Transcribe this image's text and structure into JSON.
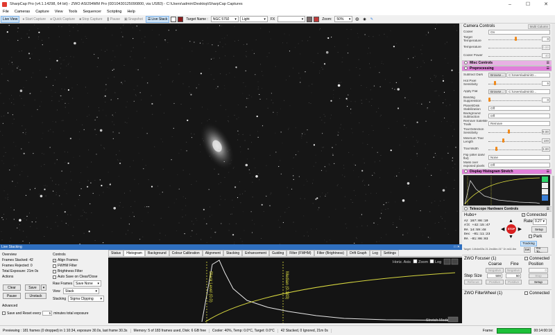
{
  "window": {
    "title": "SharpCap Pro (v4.1.14298, 64 bit) - ZWO ASI294MM Pro (0D10430125090800, via USB3) - C:\\Users\\admin\\Desktop\\SharpCap Captures"
  },
  "menu": [
    "File",
    "Cameras",
    "Capture",
    "View",
    "Tools",
    "Sequencer",
    "Scripting",
    "Help"
  ],
  "toolbar": {
    "live_view": "Live View",
    "start_capture": "Start Capture",
    "quick_capture": "Quick Capture",
    "stop_capture": "Stop Capture",
    "pause": "Pause",
    "snapshot": "Snapshot",
    "live_stack": "Live Stack",
    "target_label": "Target Name :",
    "target_value": "NGC 5792",
    "frame_type": "Light",
    "fx_label": "FX",
    "zoom_label": "Zoom:",
    "zoom_value": "50%"
  },
  "camera_controls": {
    "title": "Camera Controls",
    "multi_column": "Multi Column",
    "cooler_label": "Cooler",
    "cooler_value": "On",
    "target_temp_label": "Target Temperature",
    "target_temp_value": "0",
    "temperature_label": "Temperature",
    "temperature_value": "0.00",
    "cooler_power_label": "Cooler Power",
    "cooler_power_value": "40"
  },
  "misc_controls": {
    "title": "Misc Controls"
  },
  "preprocessing": {
    "title": "Preprocessing",
    "subtract_dark_label": "Subtract Dark",
    "browse": "Browse...",
    "subtract_dark_path": "C:\\Users\\admin\\D...",
    "hot_pixel_label": "Hot Pixel Sensitivity",
    "hot_pixel_value": "5",
    "apply_flat_label": "Apply Flat",
    "apply_flat_path": "C:\\Users\\admin\\D...",
    "banding_label": "Banding Suppression",
    "banding_value": "0",
    "planet_label": "Planet/Disk Stabilization",
    "planet_value": "Off",
    "background_label": "Background Subtraction",
    "background_value": "Off",
    "remove_trails_label": "Remove Satellite Trails",
    "remove_trails_value": "Remove",
    "trail_sens_label": "Trail Detection Sensitivity",
    "trail_sens_value": "9.00",
    "min_trail_label": "Minimum Trail Length",
    "min_trail_value": "100",
    "trail_width_label": "Trail Width",
    "trail_width_value": "3.00",
    "flip_label": "Flip (after dark/ flat)",
    "flip_value": "None",
    "mask_label": "Mask over exposed pixels",
    "mask_value": "Off"
  },
  "display_histogram": {
    "title": "Display Histogram Stretch"
  },
  "telescope": {
    "title": "Telescope Hardware Controls",
    "hubo": "Hubo+",
    "connected": "Connected",
    "az_label": "Az",
    "az_value": "167:06:10",
    "alt_label": "Alt",
    "alt_value": "+42:15:47",
    "ra_label": "RA",
    "ra_value": "14:59:48",
    "dec_label": "Dec",
    "dec_value": "-01:11:23",
    "rate_label": "Rate:",
    "rate_value": "0.27",
    "setup": "Setup",
    "park": "Park",
    "stop": "STOP",
    "tracking": "Tracking",
    "target_line": "Target: 14h4m53s 21.2m48m-01° 1h m11.6m",
    "set": "Set",
    "goto": "Go To..."
  },
  "focuser": {
    "title": "ZWO Focuser (1)",
    "connected": "Connected",
    "coarse": "Coarse",
    "fine": "Fine",
    "position": "Position",
    "negative": "Negative",
    "positive": "Positive",
    "position_value": "0",
    "step_size_label": "Step Size",
    "coarse_step": "500",
    "fine_step": "50",
    "stop": "Stop",
    "refocus": "Refocus",
    "setup": "Setup"
  },
  "filterwheel": {
    "title": "ZWO FilterWheel (1)",
    "connected": "Connected"
  },
  "live_stacking": {
    "title": "Live Stacking",
    "overview": "Overview",
    "frames_stacked_label": "Frames Stacked:",
    "frames_stacked_value": "42",
    "frames_rejected_label": "Frames Rejected:",
    "frames_rejected_value": "0",
    "total_exposure_label": "Total Exposure:",
    "total_exposure_value": "21m 0s",
    "actions": "Actions",
    "clear": "Clear",
    "save": "Save",
    "pause": "Pause",
    "unstack": "Unstack",
    "advanced": "Advanced",
    "save_reset": "Save and Reset every",
    "save_reset_num": "5",
    "save_reset_suffix": "minutes total exposure",
    "controls": "Controls",
    "align_frames": "Align Frames",
    "fwhm_filter": "FWHM Filter",
    "brightness_filter": "Brightness Filter",
    "auto_save": "Auto Save on Clear/Close",
    "raw_frames_label": "Raw Frames",
    "raw_frames_value": "Save None",
    "view_label": "View",
    "view_value": "Stack",
    "stacking_label": "Stacking",
    "stacking_value": "Sigma Clipping"
  },
  "tabs": [
    "Status",
    "Histogram",
    "Background",
    "Colour Calibration",
    "Alignment",
    "Stacking",
    "Enhancement",
    "Guiding",
    "Filter (FWHM)",
    "Filter (Brightness)",
    "Drift Graph",
    "Log",
    "Settings"
  ],
  "histogram": {
    "horiz_axis": "Horiz. Axis",
    "zoom": "Zoom",
    "log": "Log",
    "black_level": "Black Level (0.0)",
    "median": "Median (0.183)",
    "stretch_mode": "Stretch Mode"
  },
  "status": {
    "preview": "Previewing : 181 frames (0 dropped) in 1:10:34, exposure 30.0s, last frame 30.3s",
    "memory": "Memory: 5 of 183 frames used, Disk: 6 GB free",
    "cooler": "Cooler: 40%, Temp: 0.0°C, Target: 0.0°C",
    "stacked": "42 Stacked, 0 Ignored, 21m 0s",
    "frame_label": "Frame:",
    "time": "00:14:00:16"
  }
}
